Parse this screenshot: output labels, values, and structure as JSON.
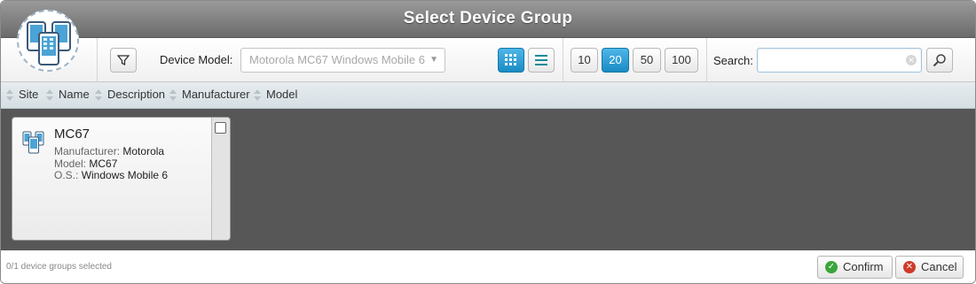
{
  "dialog": {
    "title": "Select Device Group"
  },
  "toolbar": {
    "device_model_label": "Device Model:",
    "device_model_value": "Motorola MC67 Windows Mobile 6",
    "page_sizes": [
      "10",
      "20",
      "50",
      "100"
    ],
    "active_page_size": "20",
    "search_label": "Search:",
    "search_value": ""
  },
  "columns": [
    "Site",
    "Name",
    "Description",
    "Manufacturer",
    "Model"
  ],
  "cards": [
    {
      "name": "MC67",
      "manufacturer_key": "Manufacturer:",
      "manufacturer": "Motorola",
      "model_key": "Model:",
      "model": "MC67",
      "os_key": "O.S.:",
      "os": "Windows Mobile 6",
      "selected": false
    }
  ],
  "footer": {
    "status": "0/1 device groups selected",
    "confirm_label": "Confirm",
    "cancel_label": "Cancel"
  },
  "colors": {
    "accent": "#1a8cc4",
    "content_bg": "#575757",
    "titlebar": "#7a7a7a",
    "confirm_icon": "#3aa63a",
    "cancel_icon": "#d03a2a"
  }
}
